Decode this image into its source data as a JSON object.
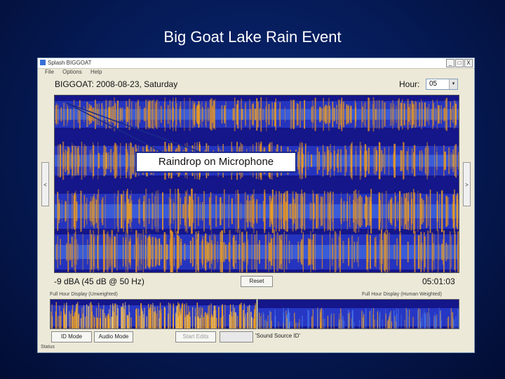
{
  "slide": {
    "title": "Big Goat Lake Rain Event"
  },
  "window": {
    "title": "Splash BIGGOAT",
    "menu": [
      "File",
      "Options",
      "Help"
    ],
    "controls": [
      "_",
      "□",
      "X"
    ]
  },
  "header": {
    "station_date": "BIGGOAT: 2008-08-23, Saturday",
    "hour_label": "Hour:",
    "hour_value": "05",
    "hour_arrow": "▾"
  },
  "spectrogram": {
    "left_arrow": "<",
    "right_arrow": ">"
  },
  "readouts": {
    "level": "-9 dBA (45 dB @   50 Hz)",
    "time": "05:01:03",
    "reset_button": "Reset"
  },
  "overview": {
    "left_label": "Full Hour Display (Unweighted)",
    "right_label": "Full Hour Display (Human Weighted)"
  },
  "buttons": {
    "id_mode": "ID Mode",
    "audio_mode": "Audio Mode",
    "start_edits": "Start Edits",
    "sound_source": "'Sound Source ID'"
  },
  "status": {
    "text": "Status"
  },
  "annotation": {
    "label": "Raindrop on Microphone"
  },
  "colors": {
    "background": "#051a55",
    "spectrogram_base": "#15178c",
    "signal": "#f0a020"
  }
}
